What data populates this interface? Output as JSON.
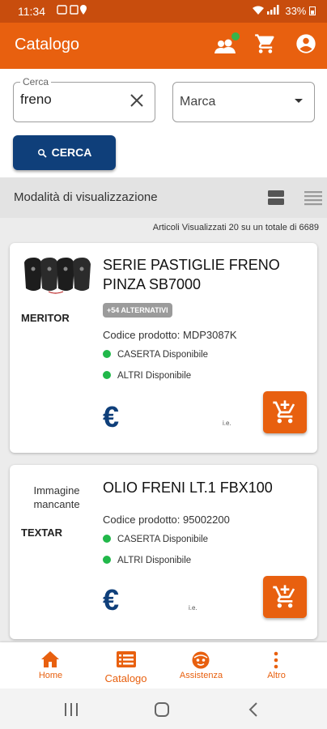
{
  "status_bar": {
    "time": "11:34",
    "battery": "33%"
  },
  "app_bar": {
    "title": "Catalogo"
  },
  "search": {
    "field_label": "Cerca",
    "field_value": "freno",
    "brand_placeholder": "Marca",
    "button_label": "CERCA"
  },
  "view": {
    "label": "Modalità di visualizzazione",
    "count_text": "Articoli Visualizzati 20 su un totale di 6689"
  },
  "products": [
    {
      "name": "SERIE PASTIGLIE FRENO PINZA SB7000",
      "brand": "MERITOR",
      "badge": "+54 ALTERNATIVI",
      "code": "Codice prodotto: MDP3087K",
      "avail1": "CASERTA Disponibile",
      "avail2": "ALTRI Disponibile",
      "currency": "€",
      "vat": "i.e."
    },
    {
      "name": "OLIO FRENI LT.1 FBX100",
      "brand": "TEXTAR",
      "image_missing": "Immagine mancante",
      "code": "Codice prodotto: 95002200",
      "avail1": "CASERTA Disponibile",
      "avail2": "ALTRI Disponibile",
      "currency": "€",
      "vat": "i.e."
    }
  ],
  "bottom_nav": [
    {
      "label": "Home",
      "icon": "home-icon"
    },
    {
      "label": "Catalogo",
      "icon": "catalog-icon",
      "active": true
    },
    {
      "label": "Assistenza",
      "icon": "support-icon"
    },
    {
      "label": "Altro",
      "icon": "more-icon"
    }
  ],
  "colors": {
    "primary": "#e8600f",
    "status_bar": "#c84d0d",
    "accent": "#0f3f7a",
    "available": "#21b84a"
  }
}
